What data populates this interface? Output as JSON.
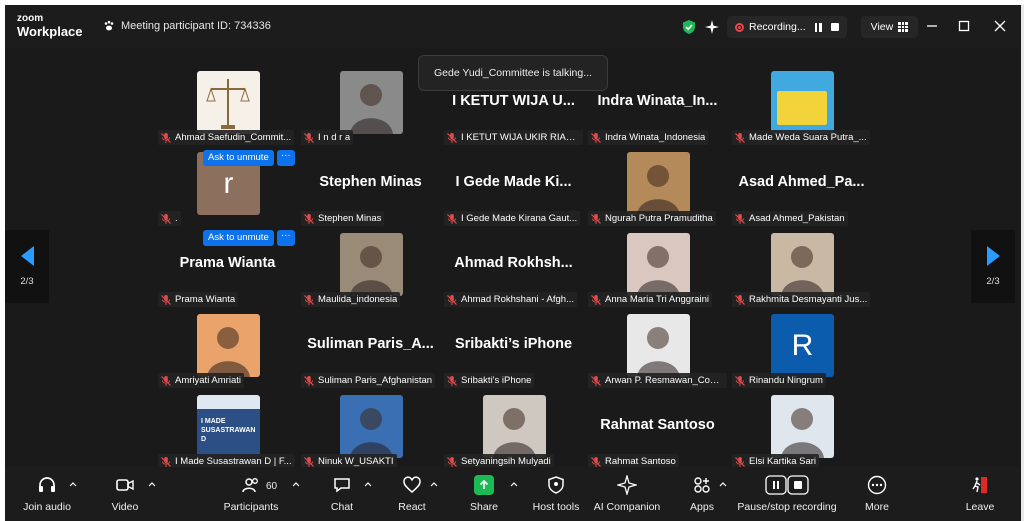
{
  "titlebar": {
    "logo_small": "zoom",
    "logo_big": "Workplace",
    "meeting_id": "Meeting participant ID: 734336",
    "recording_label": "Recording...",
    "view_label": "View"
  },
  "toast": "Gede Yudi_Committee is talking...",
  "pager": {
    "left": "2/3",
    "right": "2/3"
  },
  "unmute": {
    "label": "Ask to unmute",
    "more": "···"
  },
  "participants": [
    {
      "tag": "Ahmad Saefudin_Commit...",
      "big": "",
      "avatar": "scales",
      "color": "#f5f0e8"
    },
    {
      "tag": "I n d r a",
      "big": "",
      "avatar": "photo",
      "color": "#8a8a8a"
    },
    {
      "tag": "I KETUT WIJA UKIR RIANA...",
      "big": "I KETUT WIJA U...",
      "avatar": "",
      "color": ""
    },
    {
      "tag": "Indra Winata_Indonesia",
      "big": "Indra Winata_In...",
      "avatar": "",
      "color": ""
    },
    {
      "tag": "Made Weda Suara Putra_...",
      "big": "",
      "avatar": "poster",
      "color": "#3fa9e0"
    },
    {
      "tag": ".",
      "big": "",
      "avatar": "letter",
      "letter": "r",
      "color": "#8c6f5d"
    },
    {
      "tag": "Stephen Minas",
      "big": "Stephen Minas",
      "avatar": "",
      "color": ""
    },
    {
      "tag": "I Gede Made Kirana Gaut...",
      "big": "I Gede Made Ki...",
      "avatar": "",
      "color": ""
    },
    {
      "tag": "Ngurah Putra Pramuditha",
      "big": "",
      "avatar": "photo",
      "color": "#b58a5a"
    },
    {
      "tag": "Asad Ahmed_Pakistan",
      "big": "Asad Ahmed_Pa...",
      "avatar": "",
      "color": ""
    },
    {
      "tag": "Prama Wianta",
      "big": "Prama Wianta",
      "avatar": "",
      "color": ""
    },
    {
      "tag": "Maulida_indonesia",
      "big": "",
      "avatar": "photo",
      "color": "#9a8b78"
    },
    {
      "tag": "Ahmad Rokhshani - Afgh...",
      "big": "Ahmad Rokhsh...",
      "avatar": "",
      "color": ""
    },
    {
      "tag": "Anna Maria Tri Anggraini",
      "big": "",
      "avatar": "photo",
      "color": "#d9c7c0"
    },
    {
      "tag": "Rakhmita Desmayanti Jus...",
      "big": "",
      "avatar": "photo",
      "color": "#c9b9a4"
    },
    {
      "tag": "Amriyati Amriati",
      "big": "",
      "avatar": "photo",
      "color": "#e9a36b"
    },
    {
      "tag": "Suliman Paris_Afghanistan",
      "big": "Suliman Paris_A...",
      "avatar": "",
      "color": ""
    },
    {
      "tag": "Sribakti's iPhone",
      "big": "Sribakti’s iPhone",
      "avatar": "",
      "color": ""
    },
    {
      "tag": "Arwan P. Resmawan_Com...",
      "big": "",
      "avatar": "photo",
      "color": "#e8e8e8"
    },
    {
      "tag": "Rinandu Ningrum",
      "big": "",
      "avatar": "letter",
      "letter": "R",
      "color": "#0b5cad"
    },
    {
      "tag": "I Made Susastrawan D | F...",
      "big": "",
      "avatar": "banner",
      "banner": "I MADE SUSASTRAWAN D",
      "color": "#2c4f86"
    },
    {
      "tag": "Ninuk W_USAKTI",
      "big": "",
      "avatar": "photo",
      "color": "#3b6fb3"
    },
    {
      "tag": "Setyaningsih Mulyadi",
      "big": "",
      "avatar": "photo",
      "color": "#cfc8c0"
    },
    {
      "tag": "Rahmat Santoso",
      "big": "Rahmat Santoso",
      "avatar": "",
      "color": ""
    },
    {
      "tag": "Elsi Kartika Sari",
      "big": "",
      "avatar": "photo",
      "color": "#dfe6ee"
    }
  ],
  "toolbar": {
    "join_audio": "Join audio",
    "video": "Video",
    "participants": "Participants",
    "participants_count": "60",
    "chat": "Chat",
    "react": "React",
    "share": "Share",
    "host_tools": "Host tools",
    "ai_companion": "AI Companion",
    "apps": "Apps",
    "pause_stop": "Pause/stop recording",
    "more": "More",
    "leave": "Leave"
  },
  "colors": {
    "accent": "#0e72ed",
    "muted_red": "#e24b4b",
    "share_green": "#1db954",
    "pager_blue": "#2a9bff"
  }
}
